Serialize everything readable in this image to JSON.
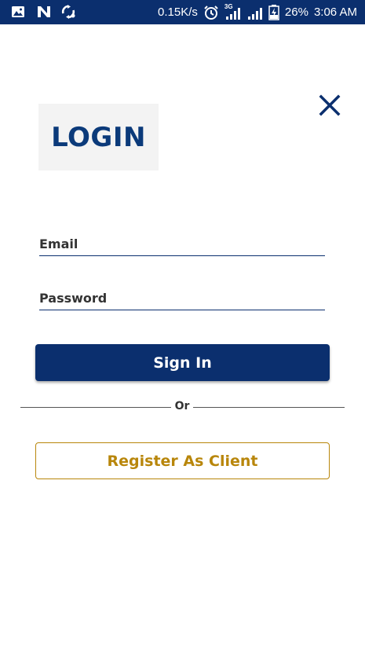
{
  "status_bar": {
    "network_speed": "0.15K/s",
    "network_type": "3G",
    "battery": "26%",
    "time": "3:06 AM",
    "left_icons": [
      "image-icon",
      "n-notification-icon",
      "sync-icon"
    ],
    "right_icons": [
      "alarm-icon",
      "signal-icon",
      "signal-icon",
      "battery-charging-icon"
    ],
    "background": "#0b2f6e"
  },
  "login": {
    "title": "LOGIN",
    "email_placeholder": "Email",
    "password_placeholder": "Password",
    "sign_in_label": "Sign In",
    "or_label": "Or",
    "register_label": "Register As Client"
  },
  "colors": {
    "primary": "#0b2f6e",
    "accent_gold": "#b8860b",
    "title_color": "#0b3a7a"
  }
}
